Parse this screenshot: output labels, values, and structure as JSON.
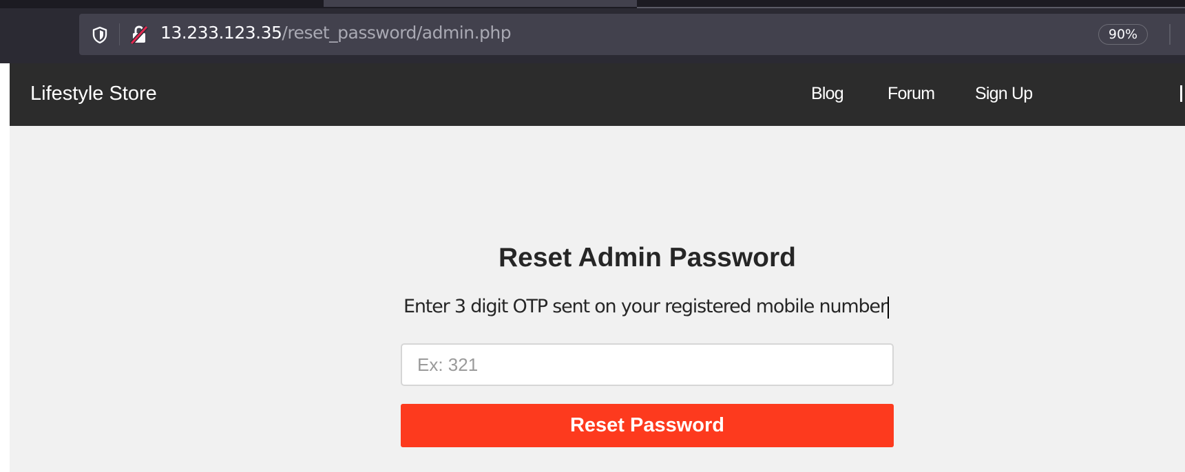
{
  "browser": {
    "url_host": "13.233.123.35",
    "url_path": "/reset_password/admin.php",
    "zoom": "90%"
  },
  "navbar": {
    "brand": "Lifestyle Store",
    "links": [
      "Blog",
      "Forum",
      "Sign Up"
    ]
  },
  "form": {
    "title": "Reset Admin Password",
    "instruction": "Enter 3 digit OTP sent on your registered mobile number",
    "otp_placeholder": "Ex: 321",
    "submit_label": "Reset Password"
  },
  "colors": {
    "navbar_bg": "#2c2c2c",
    "page_bg": "#f1f1f1",
    "button_bg": "#fd3a1e"
  }
}
